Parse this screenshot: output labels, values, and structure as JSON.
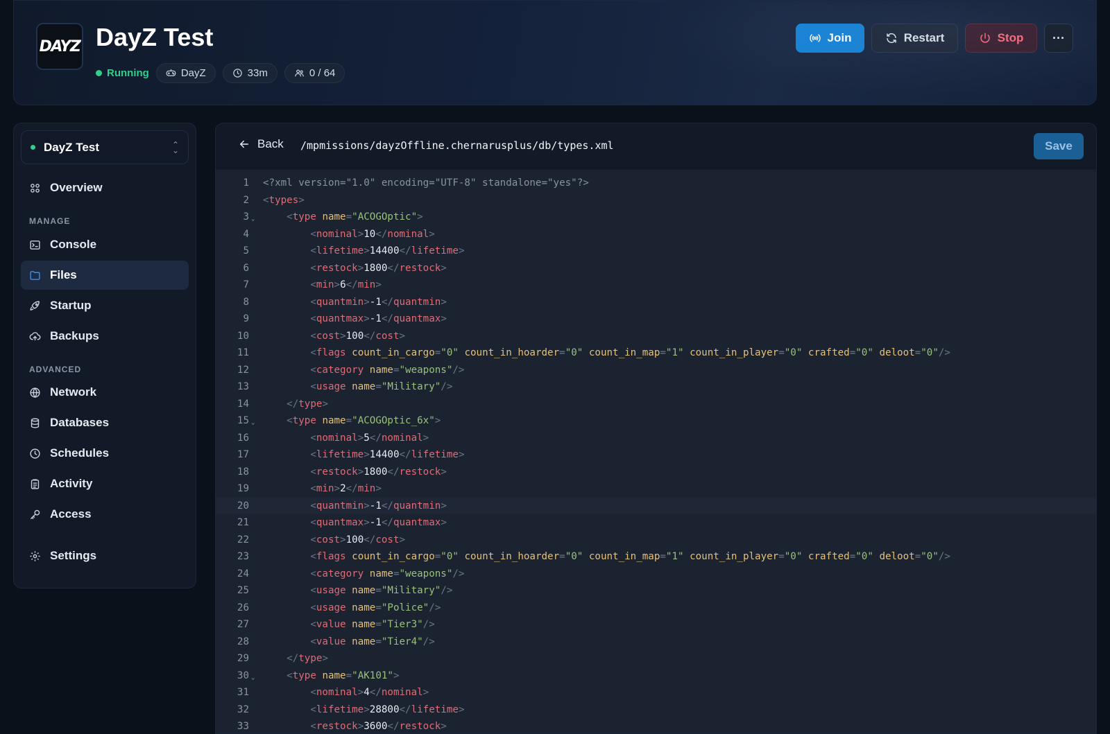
{
  "header": {
    "logo_text": "DAYZ",
    "title": "DayZ Test",
    "status": "Running",
    "game": "DayZ",
    "uptime": "33m",
    "players": "0 / 64",
    "buttons": {
      "join": "Join",
      "restart": "Restart",
      "stop": "Stop",
      "more": "···"
    }
  },
  "sidebar": {
    "server_name": "DayZ Test",
    "overview": "Overview",
    "section_manage": "MANAGE",
    "manage_items": [
      "Console",
      "Files",
      "Startup",
      "Backups"
    ],
    "section_advanced": "ADVANCED",
    "advanced_items": [
      "Network",
      "Databases",
      "Schedules",
      "Activity",
      "Access"
    ],
    "settings": "Settings",
    "active_item": "Files"
  },
  "editor": {
    "back_label": "Back",
    "file_path": "/mpmissions/dayzOffline.chernarusplus/db/types.xml",
    "save_label": "Save",
    "current_line": 20,
    "lines": [
      "<?xml version=\"1.0\" encoding=\"UTF-8\" standalone=\"yes\"?>",
      "<types>",
      "    <type name=\"ACOGOptic\">",
      "        <nominal>10</nominal>",
      "        <lifetime>14400</lifetime>",
      "        <restock>1800</restock>",
      "        <min>6</min>",
      "        <quantmin>-1</quantmin>",
      "        <quantmax>-1</quantmax>",
      "        <cost>100</cost>",
      "        <flags count_in_cargo=\"0\" count_in_hoarder=\"0\" count_in_map=\"1\" count_in_player=\"0\" crafted=\"0\" deloot=\"0\"/>",
      "        <category name=\"weapons\"/>",
      "        <usage name=\"Military\"/>",
      "    </type>",
      "    <type name=\"ACOGOptic_6x\">",
      "        <nominal>5</nominal>",
      "        <lifetime>14400</lifetime>",
      "        <restock>1800</restock>",
      "        <min>2</min>",
      "        <quantmin>-1</quantmin>",
      "        <quantmax>-1</quantmax>",
      "        <cost>100</cost>",
      "        <flags count_in_cargo=\"0\" count_in_hoarder=\"0\" count_in_map=\"1\" count_in_player=\"0\" crafted=\"0\" deloot=\"0\"/>",
      "        <category name=\"weapons\"/>",
      "        <usage name=\"Military\"/>",
      "        <usage name=\"Police\"/>",
      "        <value name=\"Tier3\"/>",
      "        <value name=\"Tier4\"/>",
      "    </type>",
      "    <type name=\"AK101\">",
      "        <nominal>4</nominal>",
      "        <lifetime>28800</lifetime>",
      "        <restock>3600</restock>"
    ],
    "fold_lines": [
      3,
      15,
      30
    ]
  }
}
